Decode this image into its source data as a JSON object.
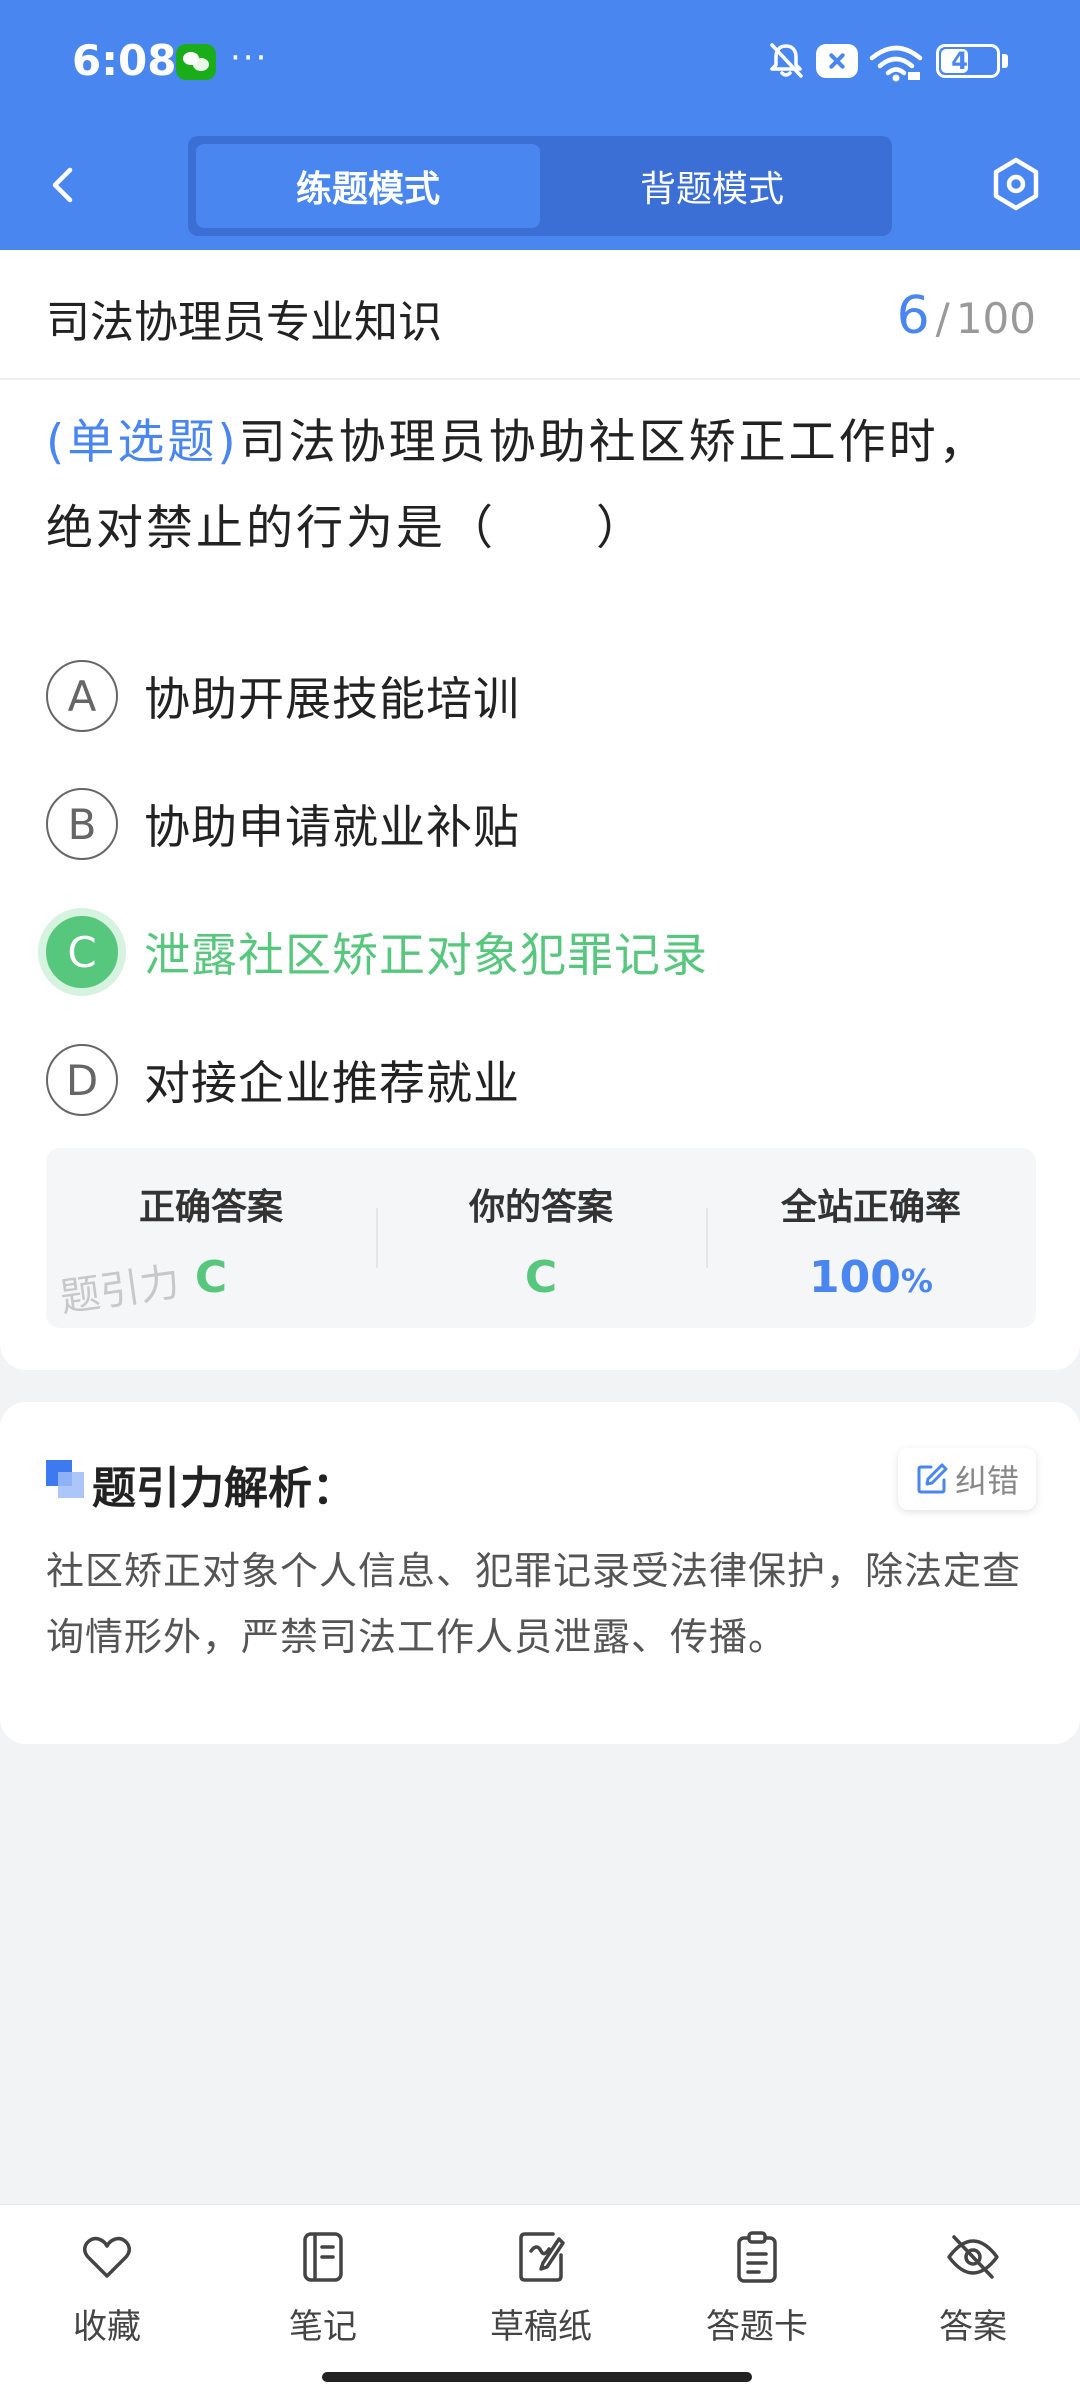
{
  "status_bar": {
    "time": "6:08",
    "dots": "···",
    "battery_level": "46",
    "icons": [
      "wechat-icon",
      "bell-off-icon",
      "close-badge-icon",
      "wifi-icon",
      "battery-icon"
    ]
  },
  "nav": {
    "tabs": [
      {
        "label": "练题模式",
        "active": true
      },
      {
        "label": "背题模式",
        "active": false
      }
    ]
  },
  "question": {
    "subject": "司法协理员专业知识",
    "current": "6",
    "separator": "/",
    "total": "100",
    "type": "(单选题)",
    "text": "司法协理员协助社区矫正工作时，绝对禁止的行为是（　　）",
    "options": [
      {
        "letter": "A",
        "text": "协助开展技能培训"
      },
      {
        "letter": "B",
        "text": "协助申请就业补贴"
      },
      {
        "letter": "C",
        "text": "泄露社区矫正对象犯罪记录",
        "selected": true
      },
      {
        "letter": "D",
        "text": "对接企业推荐就业"
      }
    ]
  },
  "answer_summary": {
    "correct_label": "正确答案",
    "correct_value": "C",
    "yours_label": "你的答案",
    "yours_value": "C",
    "rate_label": "全站正确率",
    "rate_value": "100",
    "rate_unit": "%",
    "watermark": "题引力"
  },
  "analysis": {
    "title": "题引力解析：",
    "report_label": "纠错",
    "text": "社区矫正对象个人信息、犯罪记录受法律保护，除法定查询情形外，严禁司法工作人员泄露、传播。"
  },
  "toolbar": {
    "items": [
      {
        "label": "收藏",
        "icon": "heart-icon"
      },
      {
        "label": "笔记",
        "icon": "notebook-icon"
      },
      {
        "label": "草稿纸",
        "icon": "draft-icon"
      },
      {
        "label": "答题卡",
        "icon": "clipboard-icon"
      },
      {
        "label": "答案",
        "icon": "eye-off-icon"
      }
    ]
  },
  "colors": {
    "brand_blue": "#4A86F0",
    "correct_green": "#58C77E",
    "background": "#F2F3F5"
  }
}
